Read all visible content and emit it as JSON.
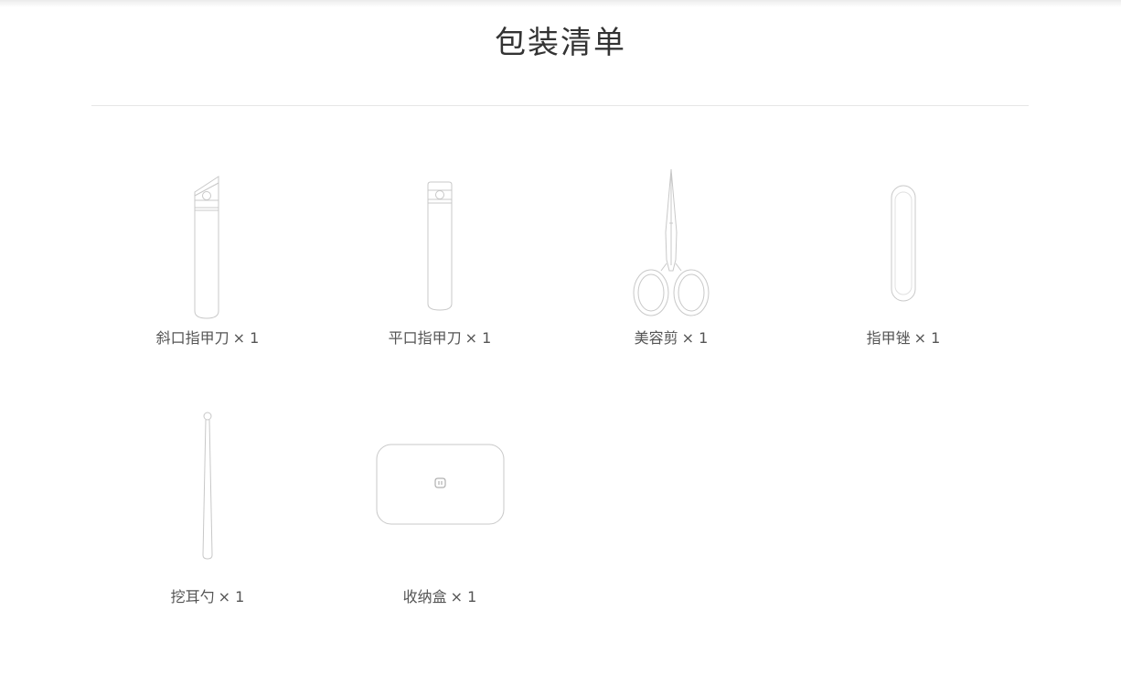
{
  "header": {
    "title": "包装清单"
  },
  "items": [
    {
      "name": "斜口指甲刀",
      "qty": "× 1",
      "icon": "slanted-nail-clipper-icon"
    },
    {
      "name": "平口指甲刀",
      "qty": "× 1",
      "icon": "straight-nail-clipper-icon"
    },
    {
      "name": "美容剪",
      "qty": "× 1",
      "icon": "scissors-icon"
    },
    {
      "name": "指甲锉",
      "qty": "× 1",
      "icon": "nail-file-icon"
    },
    {
      "name": "挖耳勺",
      "qty": "× 1",
      "icon": "ear-pick-icon"
    },
    {
      "name": "收纳盒",
      "qty": "× 1",
      "icon": "storage-case-icon"
    }
  ],
  "colors": {
    "outline": "#c8c8c8",
    "title": "#333333",
    "label": "#555555",
    "divider": "#e6e6e6"
  }
}
